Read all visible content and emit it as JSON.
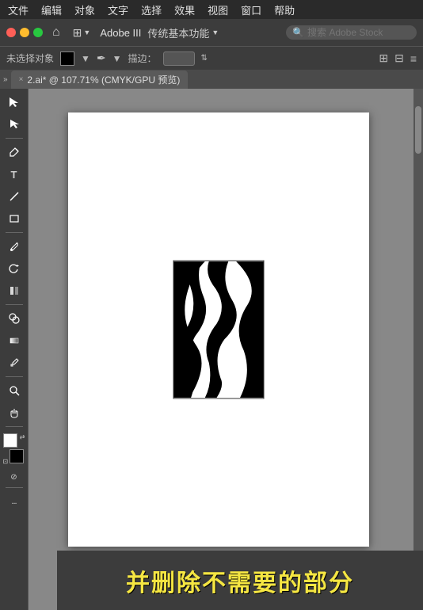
{
  "menubar": {
    "items": [
      "文件",
      "编辑",
      "对象",
      "文字",
      "选择",
      "效果",
      "视图",
      "窗口",
      "帮助"
    ]
  },
  "toolbar_top": {
    "workspace_label": "Adobe III",
    "workspace_dropdown_label": "传统基本功能",
    "search_placeholder": "搜索 Adobe Stock"
  },
  "toolbar_secondary": {
    "object_select": "未选择对象",
    "stroke_label": "描边：",
    "stroke_value": ""
  },
  "tab": {
    "close_symbol": "×",
    "title": "2.ai* @ 107.71% (CMYK/GPU 预览)"
  },
  "tools": {
    "items": [
      "↖",
      "✎",
      "✒",
      "⬜",
      "╱",
      "T",
      "↺",
      "◇",
      "⊙",
      "⬚",
      "✏",
      "🔍",
      "✋",
      "⬚",
      "↔"
    ]
  },
  "annotation": {
    "text": "并删除不需要的部分"
  },
  "colors": {
    "menu_bg": "#2a2a2a",
    "toolbar_bg": "#3c3c3c",
    "canvas_bg": "#888888",
    "artboard_bg": "#ffffff",
    "annotation_color": "#f5e642"
  }
}
